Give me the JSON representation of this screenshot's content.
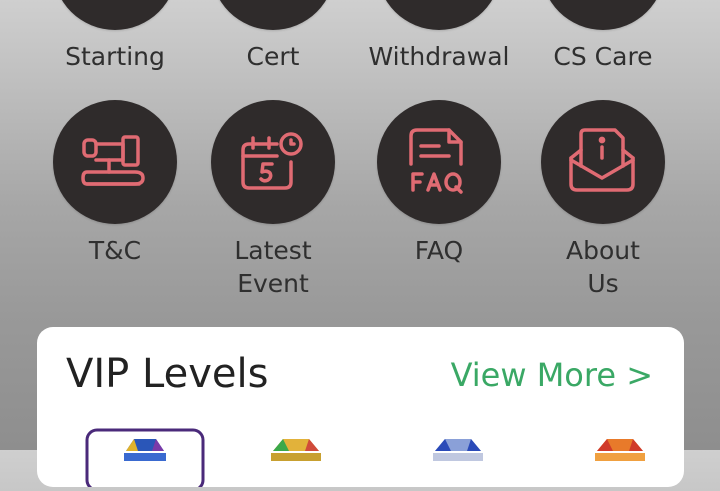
{
  "menu": {
    "row1": [
      {
        "label": "Starting"
      },
      {
        "label": "Cert"
      },
      {
        "label": "Withdrawal"
      },
      {
        "label": "CS Care"
      }
    ],
    "row2": [
      {
        "label": "T&C",
        "icon": "gavel-icon"
      },
      {
        "label": "Latest\nEvent",
        "icon": "calendar-icon"
      },
      {
        "label": "FAQ",
        "icon": "faq-icon"
      },
      {
        "label": "About\nUs",
        "icon": "info-envelope-icon"
      }
    ]
  },
  "vip": {
    "title": "VIP Levels",
    "view_more": "View More >"
  },
  "colors": {
    "icon_stroke": "#e06b73",
    "circle": "#2f2b2b",
    "accent_green": "#3aa865"
  }
}
